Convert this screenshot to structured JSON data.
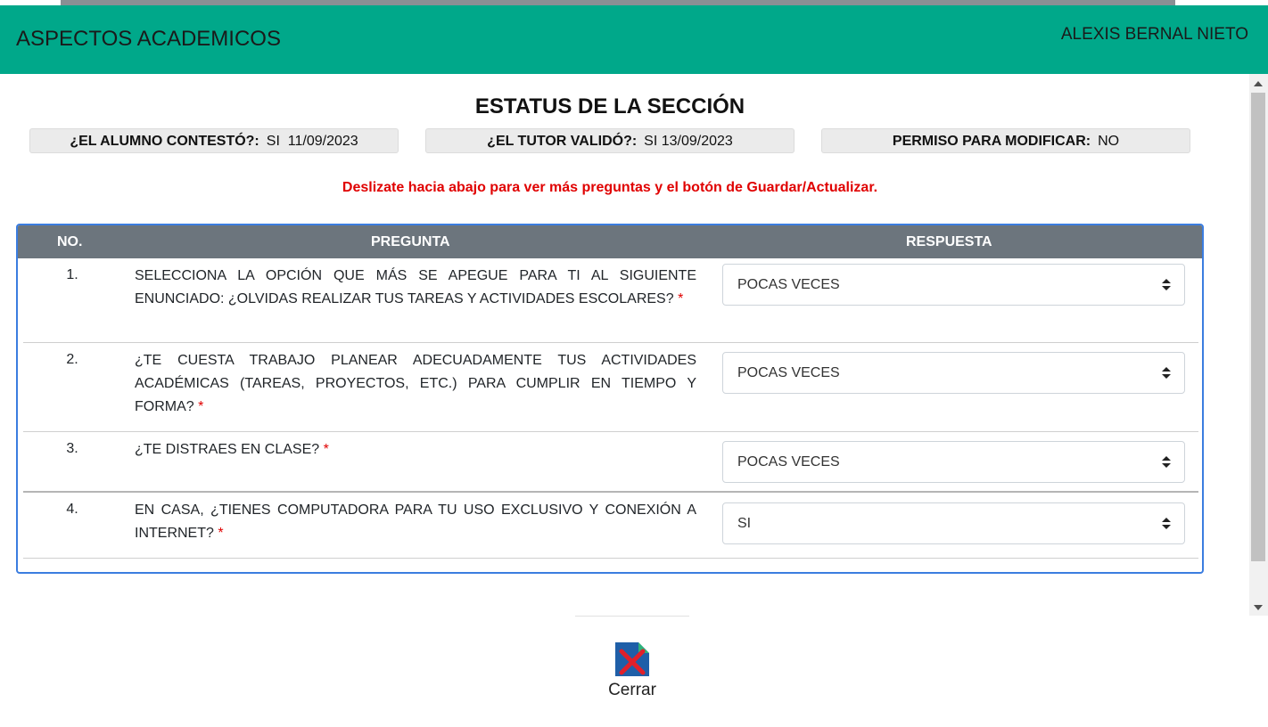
{
  "header": {
    "title": "ASPECTOS ACADEMICOS",
    "user": "ALEXIS BERNAL NIETO"
  },
  "section": {
    "title": "ESTATUS DE LA SECCIÓN"
  },
  "status": [
    {
      "label": "¿EL ALUMNO CONTESTÓ?:",
      "value": "SI  11/09/2023"
    },
    {
      "label": "¿EL TUTOR VALIDÓ?:",
      "value": "SI 13/09/2023"
    },
    {
      "label": "PERMISO PARA MODIFICAR:",
      "value": "NO"
    }
  ],
  "hint": "Deslizate hacia abajo para ver más preguntas y el botón de Guardar/Actualizar.",
  "table": {
    "headers": {
      "no": "NO.",
      "question": "PREGUNTA",
      "answer": "RESPUESTA"
    },
    "required_mark": "*",
    "rows": [
      {
        "no": "1.",
        "question": "SELECCIONA LA OPCIÓN QUE MÁS SE APEGUE PARA TI AL SIGUIENTE ENUNCIADO: ¿OLVIDAS REALIZAR TUS TAREAS Y ACTIVIDADES ESCOLARES?",
        "answer": "POCAS VECES"
      },
      {
        "no": "2.",
        "question": "¿TE CUESTA TRABAJO PLANEAR ADECUADAMENTE TUS ACTIVIDADES ACADÉMICAS (TAREAS, PROYECTOS, ETC.) PARA CUMPLIR EN TIEMPO Y FORMA?",
        "answer": "POCAS VECES"
      },
      {
        "no": "3.",
        "question": "¿TE DISTRAES EN CLASE?",
        "answer": "POCAS VECES"
      },
      {
        "no": "4.",
        "question": "EN CASA, ¿TIENES COMPUTADORA PARA TU USO EXCLUSIVO Y CONEXIÓN A INTERNET?",
        "answer": "SI"
      }
    ]
  },
  "close_button": {
    "label": "Cerrar",
    "icon": "close-document-icon"
  },
  "colors": {
    "header": "#00a88a",
    "table_header": "#6c757d",
    "table_border": "#3b7de0",
    "required": "#e00000"
  }
}
